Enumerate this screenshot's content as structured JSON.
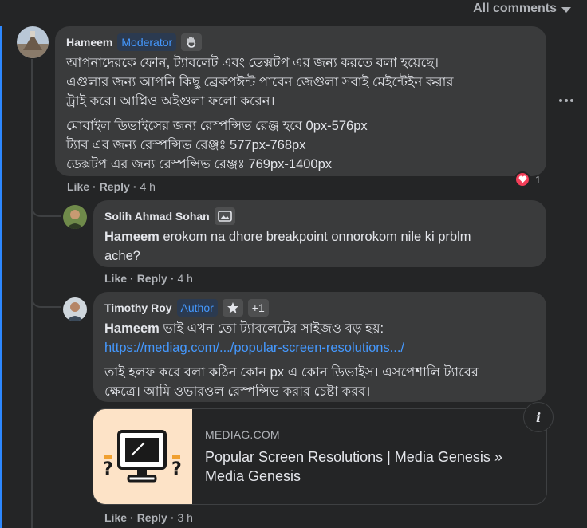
{
  "header": {
    "sort_label": "All comments"
  },
  "colors": {
    "accent": "#2d88ff",
    "background": "#242526",
    "bubble": "#3a3b3c",
    "link": "#4599ff",
    "heart": "#f33e58"
  },
  "comments": [
    {
      "author": "Hameem",
      "badge": "Moderator",
      "badge_icon": "waving-hand-icon",
      "lines": [
        "আপনাদেরকে ফোন, ট্যাবলেট এবং ডেক্সটপ এর জন্য করতে বলা হয়েছে।",
        "এগুলার জন্য আপনি কিছু ব্রেকপঈন্ট পাবেন জেগুলা সবাই মেইন্টেইন করার",
        "ট্রাই করে। আপ্নিও অইগুলা ফলো করেন।"
      ],
      "lines2": [
        "মোবাইল ডিভাইসের জন্য রেস্পন্সিভ রেঞ্জ হবে 0px-576px",
        "ট্যাব এর জন্য রেস্পন্সিভ রেঞ্জঃ 577px-768px",
        "ডেক্সটপ এর জন্য রেস্পন্সিভ রেঞ্জঃ 769px-1400px"
      ],
      "like": "Like",
      "reply": "Reply",
      "time": "4 h",
      "reaction_count": "1"
    },
    {
      "author": "Solih Ahmad Sohan",
      "badge_icon": "photo-icon",
      "mention": "Hameem",
      "text_line1": " erokom na dhore breakpoint onnorokom nile ki prblm",
      "text_line2": "ache?",
      "like": "Like",
      "reply": "Reply",
      "time": "4 h"
    },
    {
      "author": "Timothy Roy",
      "badge": "Author",
      "badge_icon": "star-icon",
      "plus": "+1",
      "mention": "Hameem",
      "text_line1": " ভাই এখন তো ট্যাবলেটের সাইজও বড় হয়:",
      "link_text": "https://mediag.com/.../popular-screen-resolutions.../",
      "lines2": [
        "তাই হলফ করে বলা কঠিন কোন px এ কোন ডিভাইস। এসপেশালি ট্যাবের",
        "ক্ষেত্রে। আমি ওভারওল রেস্পন্সিভ করার চেষ্টা করব।"
      ],
      "like": "Like",
      "reply": "Reply",
      "time": "3 h",
      "link_preview": {
        "domain": "MEDIAG.COM",
        "title_line1": "Popular Screen Resolutions | Media Genesis »",
        "title_line2": "Media Genesis",
        "info_icon": "i"
      }
    }
  ]
}
